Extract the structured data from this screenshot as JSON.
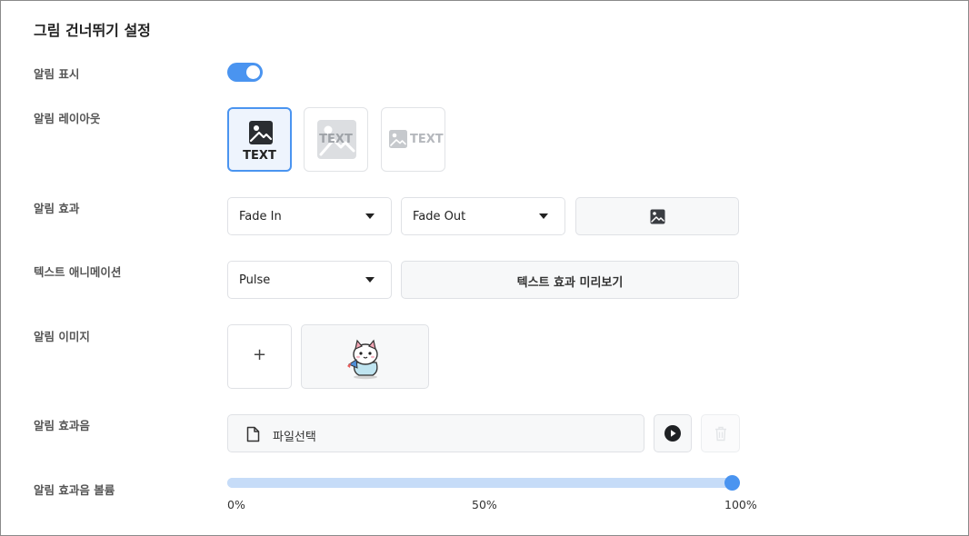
{
  "title": "그림 건너뛰기 설정",
  "labels": {
    "show_alert": "알림 표시",
    "layout": "알림 레이아웃",
    "effect": "알림 효과",
    "text_anim": "텍스트 애니메이션",
    "image": "알림 이미지",
    "sound": "알림 효과음",
    "volume": "알림 효과음 볼륨"
  },
  "toggle": {
    "on": true,
    "accent": "#4a94f0"
  },
  "layout_options": [
    {
      "text": "TEXT",
      "selected": true,
      "kind": "image-above-text"
    },
    {
      "text": "TEXT",
      "selected": false,
      "kind": "text-over-image"
    },
    {
      "text": "TEXT",
      "selected": false,
      "kind": "image-beside-text"
    }
  ],
  "effect": {
    "in": "Fade In",
    "out": "Fade Out",
    "preview_icon": "image-icon"
  },
  "text_animation": {
    "value": "Pulse",
    "preview_label": "텍스트 효과 미리보기"
  },
  "image": {
    "add_label": "+",
    "preview": "cat-sticker"
  },
  "sound": {
    "file_label": "파일선택",
    "play_icon": "play-icon",
    "delete_icon": "trash-icon"
  },
  "volume": {
    "value": 100,
    "ticks": [
      "0%",
      "50%",
      "100%"
    ]
  }
}
